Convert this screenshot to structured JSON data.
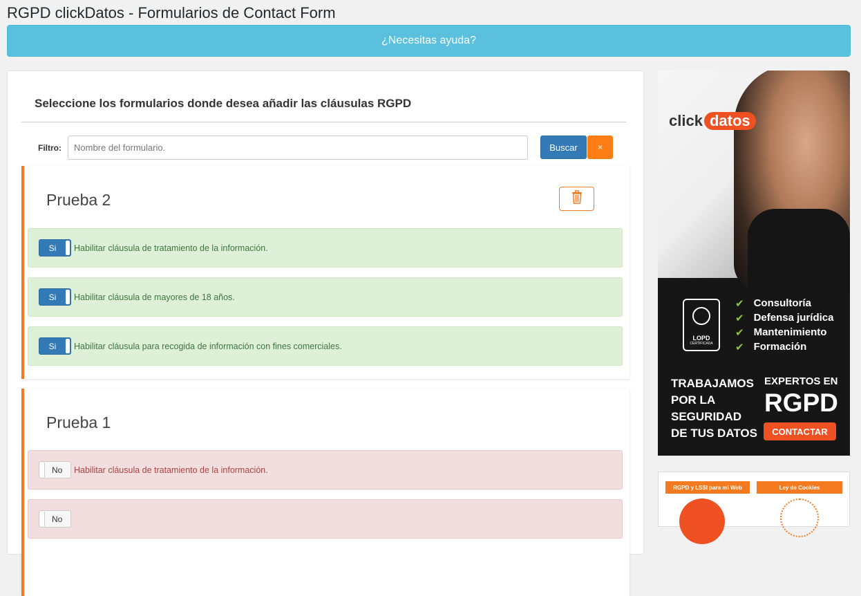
{
  "page": {
    "title": "RGPD clickDatos - Formularios de Contact Form",
    "help_label": "¿Necesitas ayuda?"
  },
  "panel": {
    "heading": "Seleccione los formularios donde desea añadir las cláusulas RGPD",
    "filter_label": "Filtro:",
    "filter_placeholder": "Nombre del formulario.",
    "filter_value": "",
    "search_label": "Buscar",
    "clear_label": "×"
  },
  "forms": [
    {
      "title": "Prueba 2",
      "options": [
        {
          "toggle": "Si",
          "enabled": true,
          "text": "Habilitar cláusula de tratamiento de la información."
        },
        {
          "toggle": "Si",
          "enabled": true,
          "text": "Habilitar cláusula de mayores de 18 años."
        },
        {
          "toggle": "Si",
          "enabled": true,
          "text": "Habilitar cláusula para recogida de información con fines comerciales."
        }
      ]
    },
    {
      "title": "Prueba 1",
      "options": [
        {
          "toggle": "No",
          "enabled": false,
          "text": "Habilitar cláusula de tratamiento de la información."
        },
        {
          "toggle": "No",
          "enabled": false,
          "text": ""
        }
      ]
    }
  ],
  "ad": {
    "logo_click": "click",
    "logo_datos": "datos",
    "badge_line1": "LOPD",
    "badge_line2": "CERTIFICADA",
    "services": [
      "Consultoría",
      "Defensa jurídica",
      "Mantenimiento",
      "Formación"
    ],
    "tagline": [
      "TRABAJAMOS",
      "POR LA",
      "SEGURIDAD",
      "DE TUS DATOS"
    ],
    "experts_line1": "EXPERTOS EN",
    "experts_line2": "RGPD",
    "contact_label": "CONTACTAR"
  },
  "ad2": {
    "tag_left": "RGPD y LSSI para mi Web",
    "tag_right": "Ley de Cookies"
  },
  "colors": {
    "accent_orange": "#f47a20",
    "help_blue": "#5bc0de",
    "primary_blue": "#337ab7",
    "success_bg": "#dff0d8",
    "danger_bg": "#f2dede"
  }
}
